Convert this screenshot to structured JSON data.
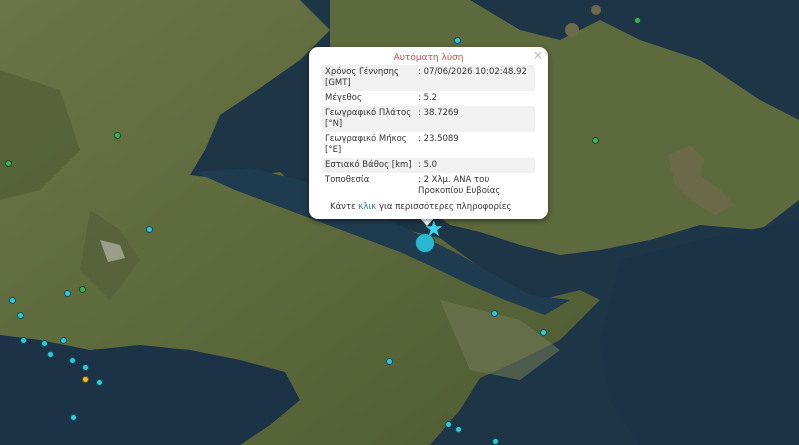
{
  "popup": {
    "title": "Αυτόματη λύση",
    "close": "×",
    "rows": [
      {
        "label": "Χρόνος Γέννησης [GMT]",
        "value": ": 07/06/2026 10:02:48.92"
      },
      {
        "label": "Μέγεθος",
        "value": ": 5.2"
      },
      {
        "label": "Γεωγραφικό Πλάτος [°N]",
        "value": ": 38.7269"
      },
      {
        "label": "Γεωγραφικό Μήκος [°E]",
        "value": ": 23.5089"
      },
      {
        "label": "Εστιακό Βάθος [km]",
        "value": ": 5.0"
      },
      {
        "label": "Τοποθεσία",
        "value": ": 2 Χλμ. ΑΝΑ του Προκοπίου Ευβοίας"
      }
    ],
    "more_prefix": "Κάντε ",
    "more_link": "κλικ",
    "more_suffix": " για περισσότερες πληροφορίες"
  },
  "colors": {
    "sea": "#1d3547",
    "land": "#5e6a3f",
    "marker_recent": "#33c6d6",
    "marker_older": "#3fae58",
    "marker_yellow": "#e2c23a",
    "popup_title": "#d64545",
    "link": "#2a6fd0"
  }
}
